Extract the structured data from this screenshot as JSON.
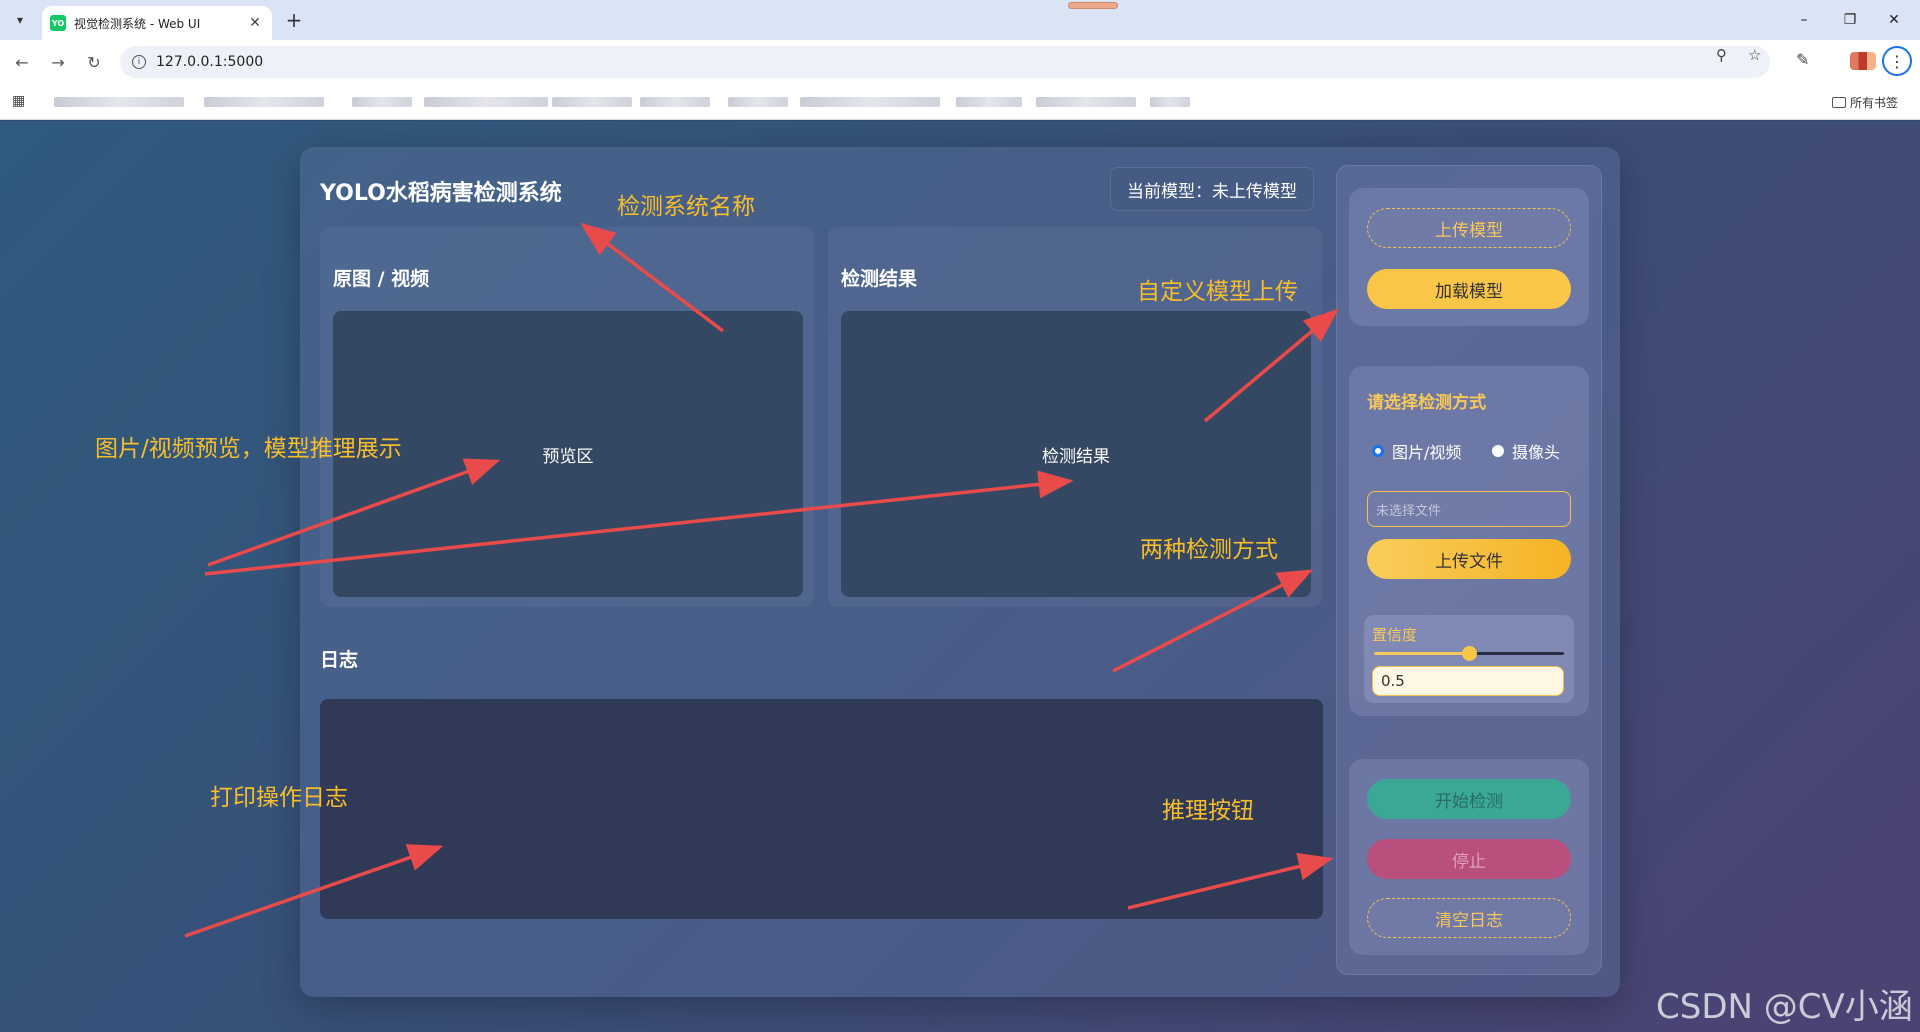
{
  "browser": {
    "tab_title": "视觉检测系统 - Web UI",
    "url": "127.0.0.1:5000",
    "favicon_text": "YO",
    "all_bookmarks": "所有书签",
    "icons": [
      "tab-list-icon",
      "close-icon",
      "plus-icon",
      "minimize-icon",
      "restore-icon",
      "back-icon",
      "forward-icon",
      "reload-icon",
      "zoom-icon",
      "star-icon",
      "extensions-icon",
      "menu-icon",
      "apps-icon",
      "folder-icon"
    ]
  },
  "app": {
    "title": "YOLO水稻病害检测系统",
    "model_status": "当前模型：未上传模型",
    "panels": {
      "source_title": "原图 / 视频",
      "source_placeholder": "预览区",
      "result_title": "检测结果",
      "result_placeholder": "检测结果"
    },
    "log_title": "日志"
  },
  "sidebar": {
    "upload_model": "上传模型",
    "load_model": "加载模型",
    "mode_title": "请选择检测方式",
    "mode_options": [
      "图片/视频",
      "摄像头"
    ],
    "selected_mode": "图片/视频",
    "file_placeholder": "未选择文件",
    "upload_file": "上传文件",
    "confidence_label": "置信度",
    "confidence_value": "0.5",
    "start": "开始检测",
    "stop": "停止",
    "clear_log": "清空日志"
  },
  "annotations": {
    "system_name": "检测系统名称",
    "custom_model": "自定义模型上传",
    "preview": "图片/视频预览，模型推理展示",
    "modes": "两种检测方式",
    "log": "打印操作日志",
    "infer": "推理按钮"
  },
  "watermark": "CSDN @CV小涵",
  "colors": {
    "accent_gold": "#f9c648",
    "annotation": "#f7bd2a",
    "arrow": "#e94a4a",
    "start_button": "#3aa895",
    "stop_button": "#b84f7d"
  }
}
